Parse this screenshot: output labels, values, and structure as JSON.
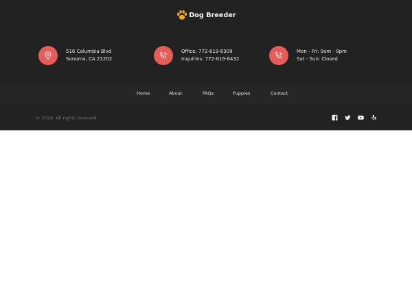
{
  "logo": {
    "text": "Dog Breeder",
    "paw_color": "#f2a91f"
  },
  "info": [
    {
      "icon": "location-pin-icon",
      "line1": "516 Columbia Blvd",
      "line2": "Sonoma, CA 21202"
    },
    {
      "icon": "phone-icon",
      "line1": "Office: 772-619-6309",
      "line2": "Inquiries: 772-619-6432"
    },
    {
      "icon": "phone-icon",
      "line1": "Mon - Fri: 9am - 8pm",
      "line2": "Sat - Sun: Closed"
    }
  ],
  "nav": {
    "home": "Home",
    "about": "About",
    "faqs": "FAQs",
    "puppies": "Puppies",
    "contact": "Contact"
  },
  "copyright": "© 2020. All rights reserved.",
  "social": [
    "facebook-icon",
    "twitter-icon",
    "youtube-icon",
    "yelp-icon"
  ],
  "colors": {
    "footer_bg": "#222223",
    "nav_band_bg": "#262627",
    "accent": "#e65c58",
    "page_bg": "#ffffff"
  }
}
